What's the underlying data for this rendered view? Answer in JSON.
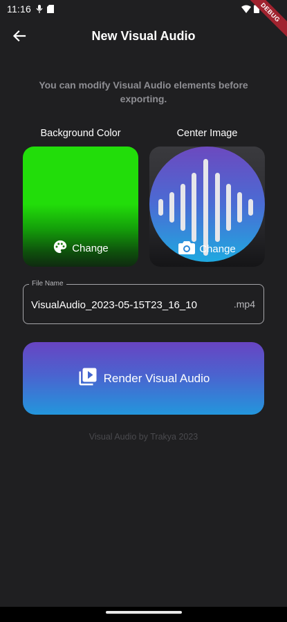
{
  "status_bar": {
    "time": "11:16",
    "debug_label": "DEBUG"
  },
  "app_bar": {
    "title": "New Visual Audio",
    "back_icon": "arrow-left-icon"
  },
  "subtitle": "You can modify Visual Audio elements before exporting.",
  "background_color": {
    "label": "Background Color",
    "change_label": "Change",
    "color_top": "#22dd0a",
    "icon": "palette-icon"
  },
  "center_image": {
    "label": "Center Image",
    "change_label": "Change",
    "icon": "camera-icon"
  },
  "file_name": {
    "label": "File Name",
    "value": "VisualAudio_2023-05-15T23_16_10",
    "suffix": ".mp4"
  },
  "render_button": {
    "label": "Render Visual Audio",
    "icon": "video-library-icon"
  },
  "footer": {
    "credit": "Visual Audio by Trakya 2023"
  },
  "colors": {
    "background": "#1f1f21",
    "accent_purple": "#6844c2",
    "accent_blue": "#2396dc",
    "muted_text": "#8e8e93"
  }
}
